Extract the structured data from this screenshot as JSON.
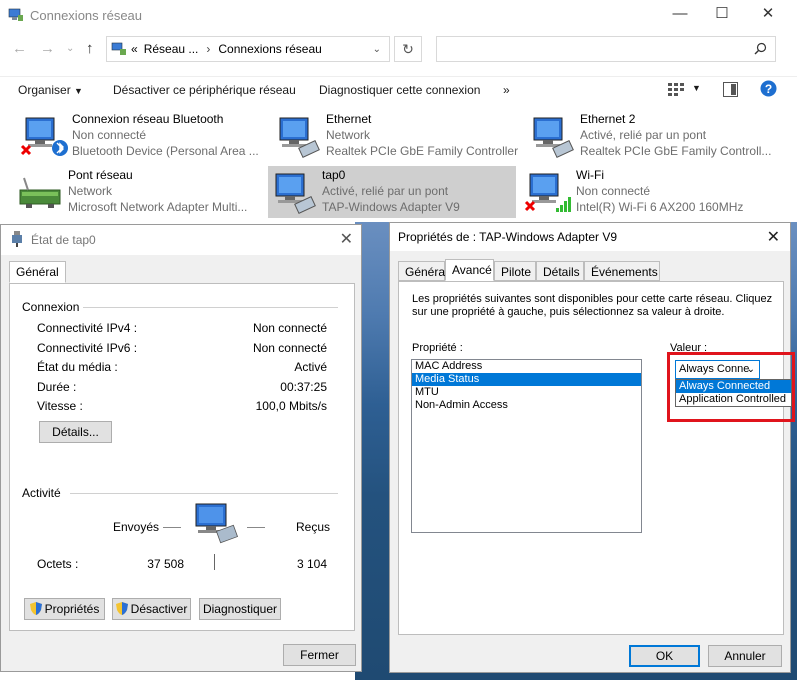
{
  "explorer": {
    "title": "Connexions réseau",
    "address": {
      "prefix": "«",
      "crumb1": "Réseau ...",
      "sep": "›",
      "crumb2": "Connexions réseau"
    },
    "commands": {
      "organize": "Organiser",
      "disable": "Désactiver ce périphérique réseau",
      "diagnose": "Diagnostiquer cette connexion",
      "more": "»"
    },
    "connections": [
      {
        "name": "Connexion réseau Bluetooth",
        "status": "Non connecté",
        "device": "Bluetooth Device (Personal Area ...",
        "icon": "network-adapter-icon",
        "overlay": "bluetooth-icon"
      },
      {
        "name": "Ethernet",
        "status": "Network",
        "device": "Realtek PCIe GbE Family Controller",
        "icon": "network-adapter-icon",
        "overlay": "cable-icon"
      },
      {
        "name": "Ethernet 2",
        "status": "Activé, relié par un pont",
        "device": "Realtek PCIe GbE Family Controll...",
        "icon": "network-adapter-icon",
        "overlay": "cable-icon"
      },
      {
        "name": "Pont réseau",
        "status": "Network",
        "device": "Microsoft Network Adapter Multi...",
        "icon": "network-bridge-icon",
        "overlay": ""
      },
      {
        "name": "tap0",
        "status": "Activé, relié par un pont",
        "device": "TAP-Windows Adapter V9",
        "icon": "network-adapter-icon",
        "overlay": "cable-icon"
      },
      {
        "name": "Wi-Fi",
        "status": "Non connecté",
        "device": "Intel(R) Wi-Fi 6 AX200 160MHz",
        "icon": "network-adapter-icon",
        "overlay": "wifi-signal-icon"
      }
    ]
  },
  "status_dialog": {
    "title": "État de tap0",
    "tab": "Général",
    "connection_group": "Connexion",
    "rows": [
      {
        "label": "Connectivité IPv4 :",
        "value": "Non connecté"
      },
      {
        "label": "Connectivité IPv6 :",
        "value": "Non connecté"
      },
      {
        "label": "État du média :",
        "value": "Activé"
      },
      {
        "label": "Durée :",
        "value": "00:37:25"
      },
      {
        "label": "Vitesse :",
        "value": "100,0 Mbits/s"
      }
    ],
    "details_button": "Détails...",
    "activity_group": "Activité",
    "sent_label": "Envoyés",
    "received_label": "Reçus",
    "octets_label": "Octets :",
    "octets_sent": "37 508",
    "octets_received": "3 104",
    "properties_button": "Propriétés",
    "disable_button": "Désactiver",
    "diagnose_button": "Diagnostiquer",
    "close_button": "Fermer"
  },
  "props_dialog": {
    "title": "Propriétés de : TAP-Windows Adapter V9",
    "tabs": [
      "Général",
      "Avancé",
      "Pilote",
      "Détails",
      "Événements"
    ],
    "active_tab": "Avancé",
    "description_line1": "Les propriétés suivantes sont disponibles pour cette carte réseau. Cliquez",
    "description_line2": "sur une propriété à gauche, puis sélectionnez sa valeur à droite.",
    "property_label": "Propriété :",
    "value_label": "Valeur :",
    "properties": [
      "MAC Address",
      "Media Status",
      "MTU",
      "Non-Admin Access"
    ],
    "selected_property": "Media Status",
    "combo_value": "Always Conne",
    "options": [
      "Always Connected",
      "Application Controlled"
    ],
    "ok_button": "OK",
    "cancel_button": "Annuler"
  },
  "colors": {
    "highlight": "#0078d7",
    "annotation_red": "#e0141c"
  }
}
